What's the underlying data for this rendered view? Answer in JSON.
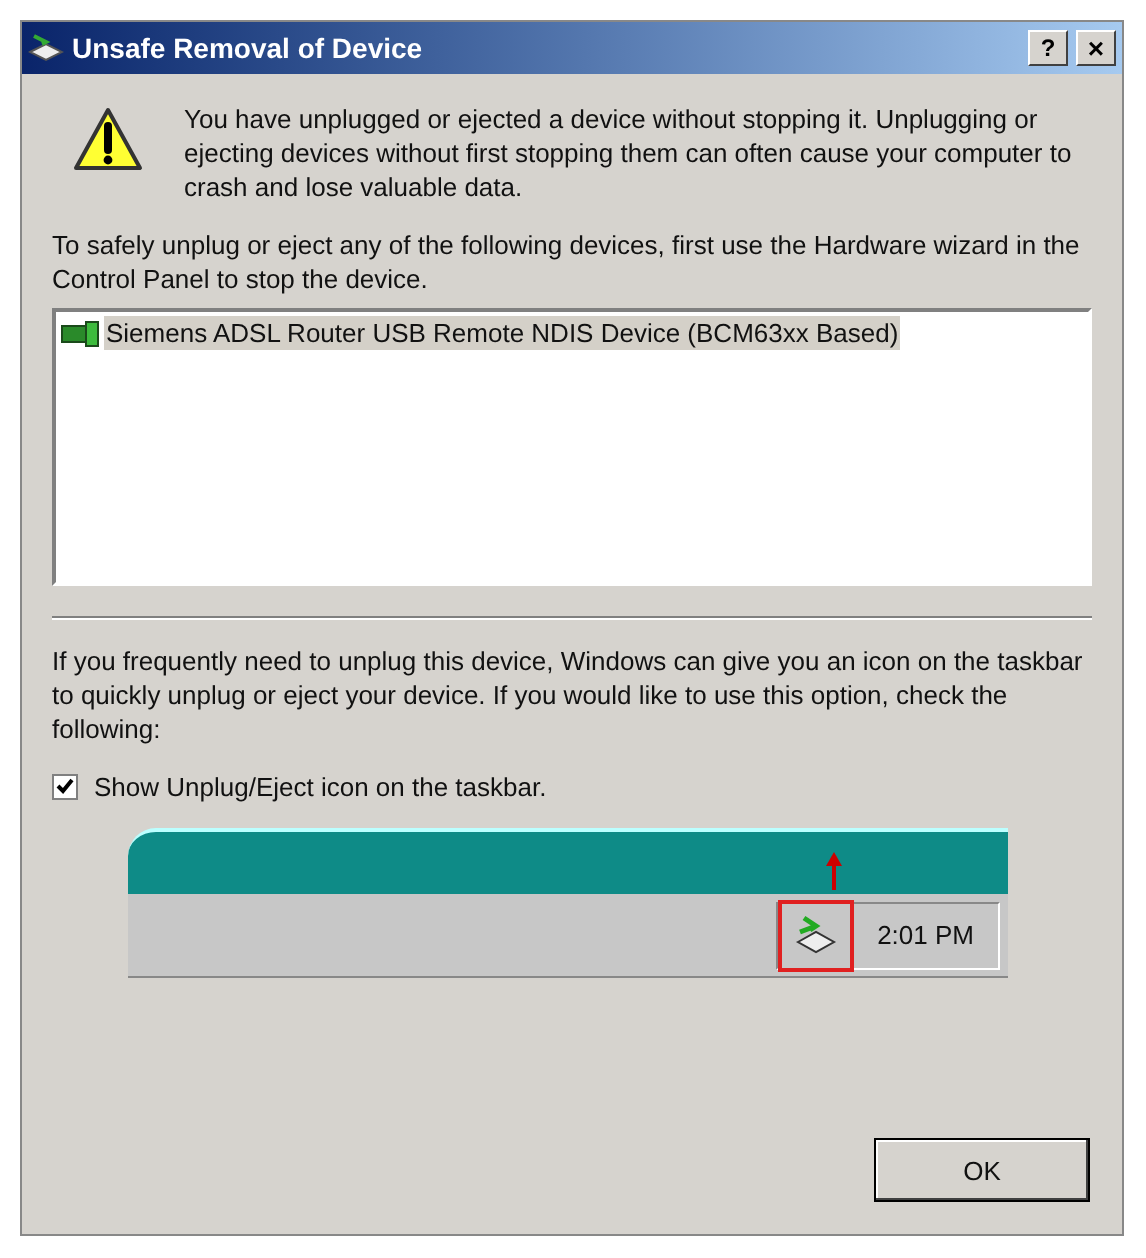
{
  "window": {
    "title": "Unsafe Removal of Device",
    "help_button": "?",
    "close_button": "×"
  },
  "warning": "You have unplugged or ejected a device without stopping it. Unplugging or ejecting devices without first stopping them can often cause your computer to crash and lose valuable data.",
  "instructions": "To safely unplug or eject any of the following devices, first use the Hardware wizard in the Control Panel to stop the device.",
  "devices": [
    {
      "name": "Siemens ADSL Router USB Remote NDIS Device (BCM63xx Based)",
      "selected": true
    }
  ],
  "option_text": "If you frequently need to unplug this device, Windows can give you an icon on the taskbar to quickly unplug or eject your device. If you would like to use this option, check the following:",
  "checkbox": {
    "label": "Show Unplug/Eject icon on the taskbar.",
    "checked": true
  },
  "taskbar_preview": {
    "clock": "2:01 PM"
  },
  "buttons": [
    "OK"
  ]
}
